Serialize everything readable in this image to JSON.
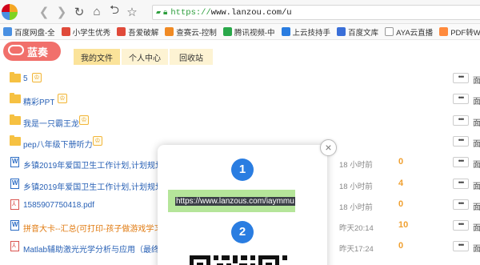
{
  "browser": {
    "url_prefix": "https://",
    "url_host": "www.lanzou.com/u"
  },
  "bookmarks": [
    {
      "label": "百度网盘-全",
      "color": "#4a90e2",
      "icon": "baidu-pan-icon"
    },
    {
      "label": "小学生优秀",
      "color": "#e04a3a",
      "icon": "paw-icon"
    },
    {
      "label": "吾爱破解",
      "color": "#e04a3a",
      "icon": "site-icon"
    },
    {
      "label": "查赛云-控制",
      "color": "#f08a24",
      "icon": "cloud-icon"
    },
    {
      "label": "腾讯视频-中",
      "color": "#2aa84a",
      "icon": "video-icon"
    },
    {
      "label": "上云技持手",
      "color": "#2a7de1",
      "icon": "globe-icon"
    },
    {
      "label": "百度文库",
      "color": "#3a6fd8",
      "icon": "baidu-icon"
    },
    {
      "label": "AYA云直播",
      "color": "#ffffff",
      "icon": "page-icon"
    },
    {
      "label": "PDF转Word同",
      "color": "#ff8a3d",
      "icon": "pdf-icon"
    }
  ],
  "site": {
    "brand": "蓝奏",
    "tabs": [
      "我的文件",
      "个人中心",
      "回收站"
    ]
  },
  "files": [
    {
      "name": "5",
      "type": "folder",
      "share": true,
      "time": "",
      "count": ""
    },
    {
      "name": "精彩PPT",
      "type": "folder",
      "share": true,
      "time": "",
      "count": ""
    },
    {
      "name": "我是一只霸王龙",
      "type": "folder",
      "share": true,
      "time": "",
      "count": ""
    },
    {
      "name": "pep八年级下册听力",
      "type": "folder",
      "share": true,
      "time": "",
      "count": ""
    },
    {
      "name": "乡镇2019年爱国卫生工作计划,计划规划-语",
      "type": "word",
      "share": false,
      "time": "18 小时前",
      "count": "0"
    },
    {
      "name": "乡镇2019年爱国卫生工作计划,计划规划-语",
      "type": "word",
      "share": false,
      "time": "18 小时前",
      "count": "4"
    },
    {
      "name": "1585907750418.pdf",
      "type": "pdf",
      "share": false,
      "time": "18 小时前",
      "count": "0"
    },
    {
      "name": "拼音大卡--汇总(可打印-孩子做游戏学习).d",
      "type": "word",
      "share": false,
      "time": "昨天20:14",
      "count": "10",
      "orange": true
    },
    {
      "name": "Matlab辅助激光光学分析与应用（最终完善",
      "type": "pdf",
      "share": false,
      "time": "昨天17:24",
      "count": "0"
    }
  ],
  "row_actions": {
    "more": "•••",
    "trunc": "面"
  },
  "popup": {
    "step1": "1",
    "link": "https://www.lanzous.com/iaymmu",
    "step2": "2",
    "close": "×"
  }
}
